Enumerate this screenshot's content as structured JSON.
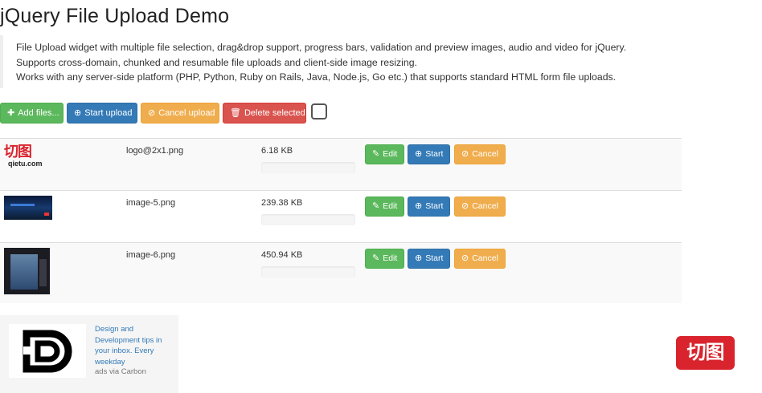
{
  "page": {
    "title": "jQuery File Upload Demo"
  },
  "description": {
    "lines": [
      "File Upload widget with multiple file selection, drag&drop support, progress bars, validation and preview images, audio and video for jQuery.",
      "Supports cross-domain, chunked and resumable file uploads and client-side image resizing.",
      "Works with any server-side platform (PHP, Python, Ruby on Rails, Java, Node.js, Go etc.) that supports standard HTML form file uploads."
    ]
  },
  "toolbar": {
    "add_files": {
      "icon": "plus-icon",
      "label": "Add files..."
    },
    "start_upload": {
      "icon": "upload-circle-icon",
      "label": "Start upload"
    },
    "cancel_upload": {
      "icon": "ban-circle-icon",
      "label": "Cancel upload"
    },
    "delete_selected": {
      "icon": "trash-icon",
      "label": "Delete selected"
    },
    "toggle_all_checked": false
  },
  "files": [
    {
      "name": "logo@2x1.png",
      "size": "6.18 KB",
      "progress": 0,
      "preview": "qietu-logo",
      "preview_text": {
        "cn": "切图",
        "domain": "qietu.com"
      }
    },
    {
      "name": "image-5.png",
      "size": "239.38 KB",
      "progress": 0,
      "preview": "dark-screenshot"
    },
    {
      "name": "image-6.png",
      "size": "450.94 KB",
      "progress": 0,
      "preview": "dark-screenshot"
    }
  ],
  "row_actions": {
    "edit": {
      "icon": "edit-icon",
      "label": "Edit"
    },
    "start": {
      "icon": "upload-circle-icon",
      "label": "Start"
    },
    "cancel": {
      "icon": "ban-circle-icon",
      "label": "Cancel"
    }
  },
  "ad": {
    "text": "Design and Development tips in your inbox. Every weekday",
    "via": "ads via Carbon",
    "logo": "D"
  },
  "brand_badge": {
    "text": "切图"
  },
  "colors": {
    "success": "#5cb85c",
    "primary": "#337ab7",
    "warning": "#f0ad4e",
    "danger": "#d9534f",
    "brand_red": "#d9232d"
  }
}
